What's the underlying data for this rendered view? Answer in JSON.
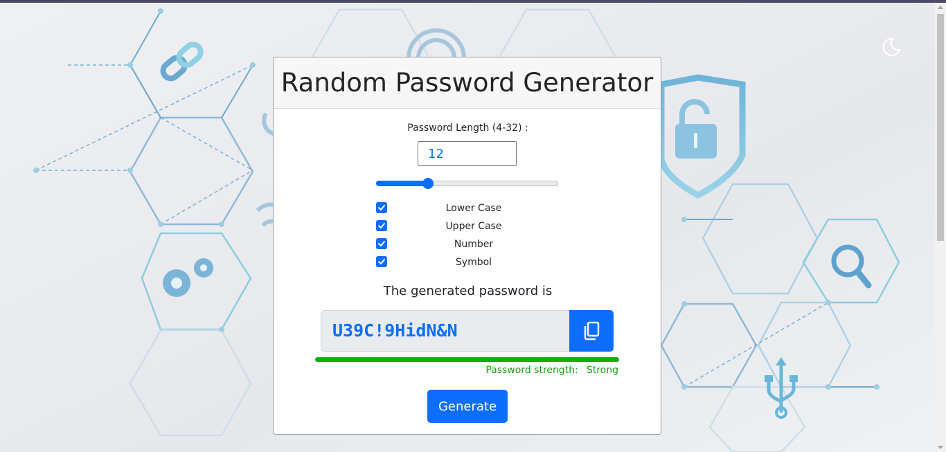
{
  "header": {
    "title": "Random Password Generator"
  },
  "theme_toggle": {
    "icon": "moon-icon"
  },
  "length": {
    "label": "Password Length (4-32) :",
    "value": "12",
    "min": 4,
    "max": 32
  },
  "options": [
    {
      "label": "Lower Case",
      "checked": true
    },
    {
      "label": "Upper Case",
      "checked": true
    },
    {
      "label": "Number",
      "checked": true
    },
    {
      "label": "Symbol",
      "checked": true
    }
  ],
  "result": {
    "title": "The generated password is",
    "password": "U39C!9HidN&N",
    "copy_icon": "copy-icon",
    "strength_label": "Password strength:",
    "strength_value": "Strong",
    "strength_fraction": 1.0
  },
  "generate_label": "Generate",
  "colors": {
    "accent": "#0d6efd",
    "strong": "#12b012",
    "background": "#e9ecef"
  }
}
